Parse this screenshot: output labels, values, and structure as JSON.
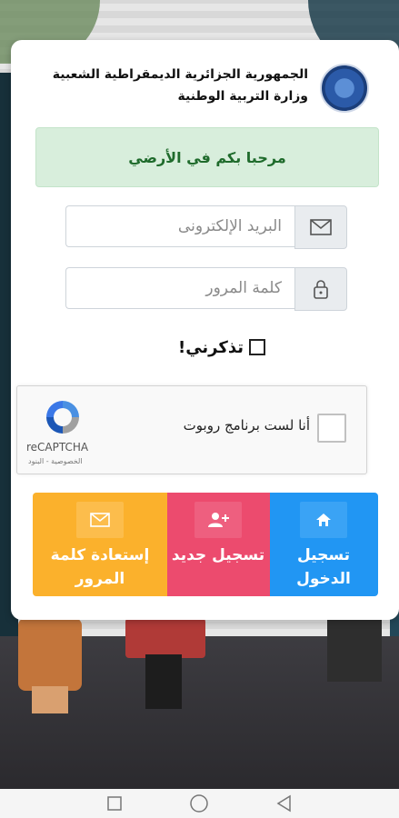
{
  "header": {
    "title_line1": "الجمهورية الجزائرية الديمقراطية الشعبية",
    "title_line2": "وزارة التربية الوطنية",
    "logo_icon": "ministry-seal-icon"
  },
  "welcome": {
    "text": "مرحبا بكم في الأرضي"
  },
  "email": {
    "placeholder": "البريد الإلكترونى",
    "icon": "envelope-icon"
  },
  "password": {
    "placeholder": "كلمة المرور",
    "icon": "lock-icon"
  },
  "remember": {
    "label": "تذكرني!",
    "checked": false
  },
  "recaptcha": {
    "label": "أنا لست برنامج روبوت",
    "brand": "reCAPTCHA",
    "links": "الخصوصية - البنود",
    "checked": false
  },
  "buttons": {
    "login": {
      "label": "تسجيل الدخول",
      "icon": "home-icon",
      "color": "#2196f3"
    },
    "register": {
      "label": "تسجيل جديد",
      "icon": "user-plus-icon",
      "color": "#ec4b6e"
    },
    "recover": {
      "label": "إستعادة كلمة المرور",
      "icon": "envelope-icon",
      "color": "#fbb12c"
    }
  },
  "navbar": {
    "icons": [
      "recent-apps-icon",
      "home-circle-icon",
      "back-triangle-icon"
    ]
  }
}
